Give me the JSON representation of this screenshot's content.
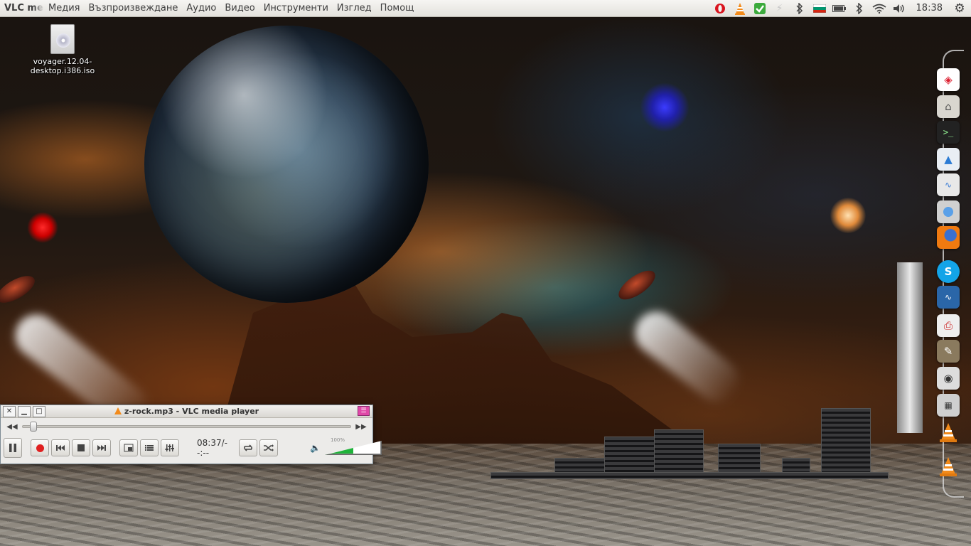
{
  "top_panel": {
    "app_name": "VLC media player",
    "menu": [
      "Медия",
      "Възпроизвеждане",
      "Аудио",
      "Видео",
      "Инструменти",
      "Изглед",
      "Помощ"
    ],
    "clock": "18:38",
    "tray_icons": [
      "opera-icon",
      "vlc-cone-icon",
      "update-check-icon",
      "power-icon",
      "bluetooth-icon",
      "keyboard-layout-flag-icon",
      "battery-icon",
      "bluetooth-icon",
      "wifi-icon",
      "volume-icon",
      "settings-gear-icon"
    ]
  },
  "desktop": {
    "icon_label": "voyager.12.04-desktop.i386.iso"
  },
  "dock": {
    "items": [
      "ubuntu-software-icon",
      "home-folder-icon",
      "terminal-icon",
      "arch-like-icon",
      "system-monitor-icon",
      "chromium-icon",
      "firefox-icon",
      "skype-icon",
      "activity-monitor-icon",
      "printer-icon",
      "gimp-icon",
      "screenshot-camera-icon",
      "calculator-icon",
      "vlc-icon",
      "vlc-icon"
    ]
  },
  "vlc": {
    "title": "z-rock.mp3 - VLC media player",
    "time": "08:37/--:--",
    "volume_label": "100%",
    "volume_fraction": 0.5
  },
  "colors": {
    "vlc_accent": "#f28a1a",
    "volume_green": "#1fb33a",
    "menu_toggle": "#e048a8"
  }
}
